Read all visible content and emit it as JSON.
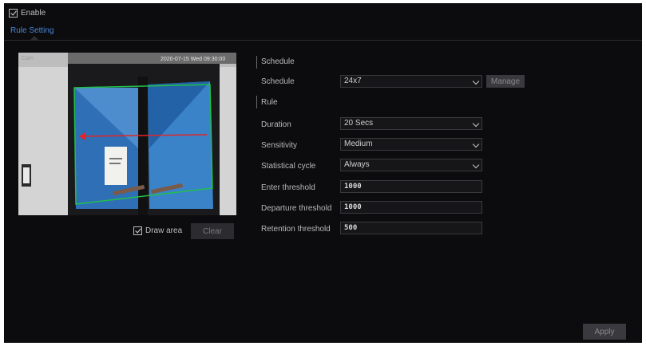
{
  "enable": {
    "label": "Enable",
    "checked": true
  },
  "tabs": [
    {
      "label": "Rule Setting",
      "active": true
    }
  ],
  "video": {
    "corner_label": "Cam",
    "overlay_text": "2020-07-15 Wed 09:30:00"
  },
  "draw_area": {
    "label": "Draw area",
    "checked": true
  },
  "buttons": {
    "clear": "Clear",
    "manage": "Manage",
    "apply": "Apply"
  },
  "schedule_section": {
    "title": "Schedule"
  },
  "schedule": {
    "label": "Schedule",
    "value": "24x7"
  },
  "rule_section": {
    "title": "Rule"
  },
  "rule_fields": {
    "duration": {
      "label": "Duration",
      "value": "20 Secs"
    },
    "sensitivity": {
      "label": "Sensitivity",
      "value": "Medium"
    },
    "statistical_cycle": {
      "label": "Statistical cycle",
      "value": "Always"
    },
    "enter_threshold": {
      "label": "Enter threshold",
      "value": "1000"
    },
    "departure_threshold": {
      "label": "Departure threshold",
      "value": "1000"
    },
    "retention_threshold": {
      "label": "Retention threshold",
      "value": "500"
    }
  },
  "colors": {
    "background": "#0c0c0e",
    "tab_accent": "#4a86d6",
    "detection_area": "#21c04a",
    "tripwire": "#e0252a"
  }
}
